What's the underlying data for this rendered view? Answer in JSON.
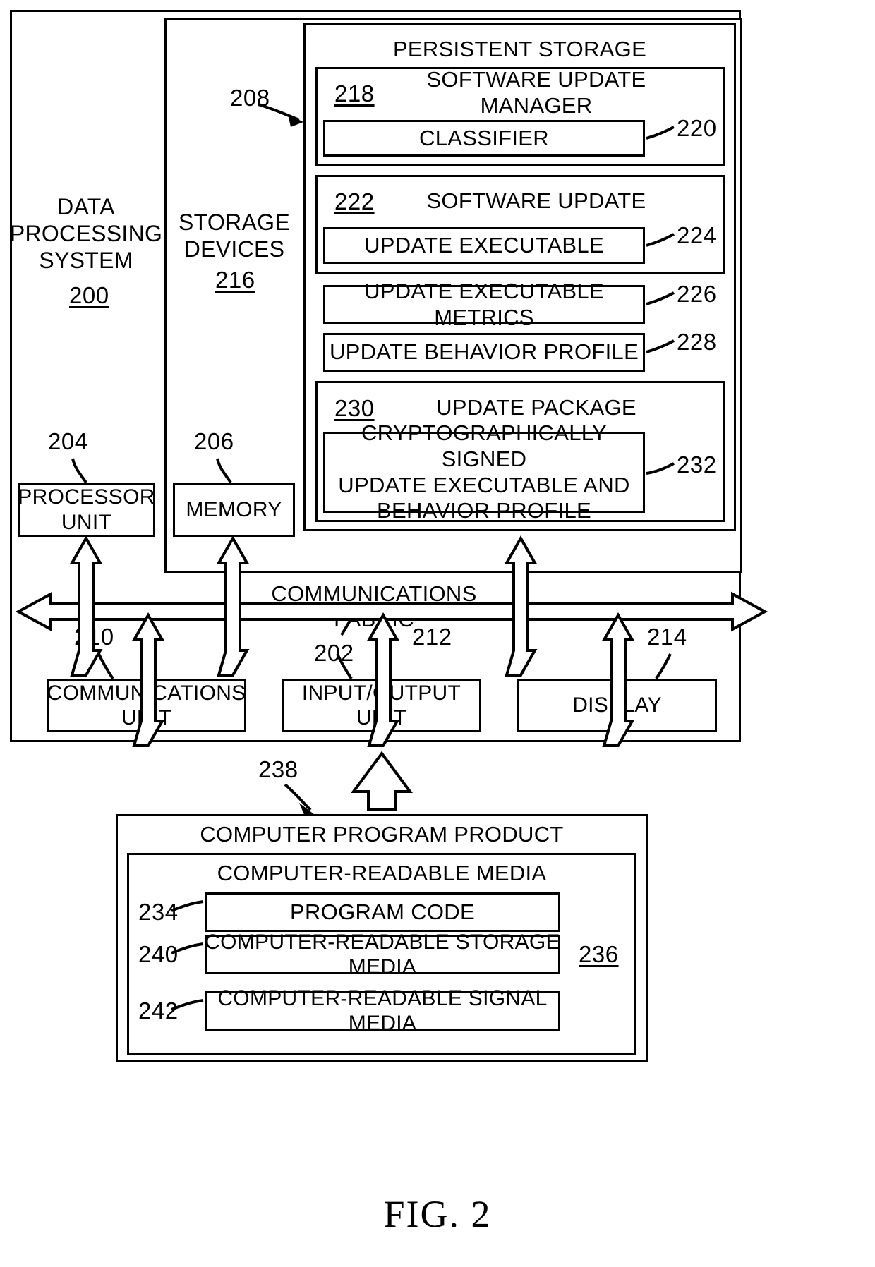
{
  "figure": {
    "caption": "FIG. 2",
    "system": {
      "title": "DATA\nPROCESSING\nSYSTEM",
      "ref": "200"
    },
    "storage_devices": {
      "title": "STORAGE\nDEVICES",
      "ref": "216",
      "callout_ref": "208"
    },
    "persistent_storage": {
      "title": "PERSISTENT STORAGE",
      "blocks": [
        {
          "ref": "218",
          "title": "SOFTWARE UPDATE MANAGER",
          "child": {
            "label": "CLASSIFIER",
            "ref": "220"
          }
        },
        {
          "ref": "222",
          "title": "SOFTWARE UPDATE",
          "child": {
            "label": "UPDATE EXECUTABLE",
            "ref": "224"
          }
        }
      ],
      "plain_blocks": [
        {
          "label": "UPDATE EXECUTABLE METRICS",
          "ref": "226"
        },
        {
          "label": "UPDATE BEHAVIOR PROFILE",
          "ref": "228"
        }
      ],
      "update_package": {
        "ref": "230",
        "title": "UPDATE PACKAGE",
        "child": {
          "label": "CRYPTOGRAPHICALLY SIGNED\nUPDATE EXECUTABLE AND\nBEHAVIOR PROFILE",
          "ref": "232"
        }
      }
    },
    "processor_unit": {
      "label": "PROCESSOR\nUNIT",
      "ref": "204"
    },
    "memory": {
      "label": "MEMORY",
      "ref": "206"
    },
    "communications_fabric": {
      "label": "COMMUNICATIONS FABRIC",
      "ref": "202"
    },
    "io_boxes": [
      {
        "label": "COMMUNICATIONS\nUNIT",
        "ref": "210"
      },
      {
        "label": "INPUT/OUTPUT\nUNIT",
        "ref": "212"
      },
      {
        "label": "DISPLAY",
        "ref": "214"
      }
    ],
    "computer_program_product": {
      "title": "COMPUTER PROGRAM PRODUCT",
      "ref": "238",
      "media": {
        "title": "COMPUTER-READABLE MEDIA",
        "ref": "236",
        "items": [
          {
            "label": "PROGRAM CODE",
            "ref": "234"
          },
          {
            "label": "COMPUTER-READABLE STORAGE MEDIA",
            "ref": "240"
          },
          {
            "label": "COMPUTER-READABLE SIGNAL MEDIA",
            "ref": "242"
          }
        ]
      }
    }
  }
}
